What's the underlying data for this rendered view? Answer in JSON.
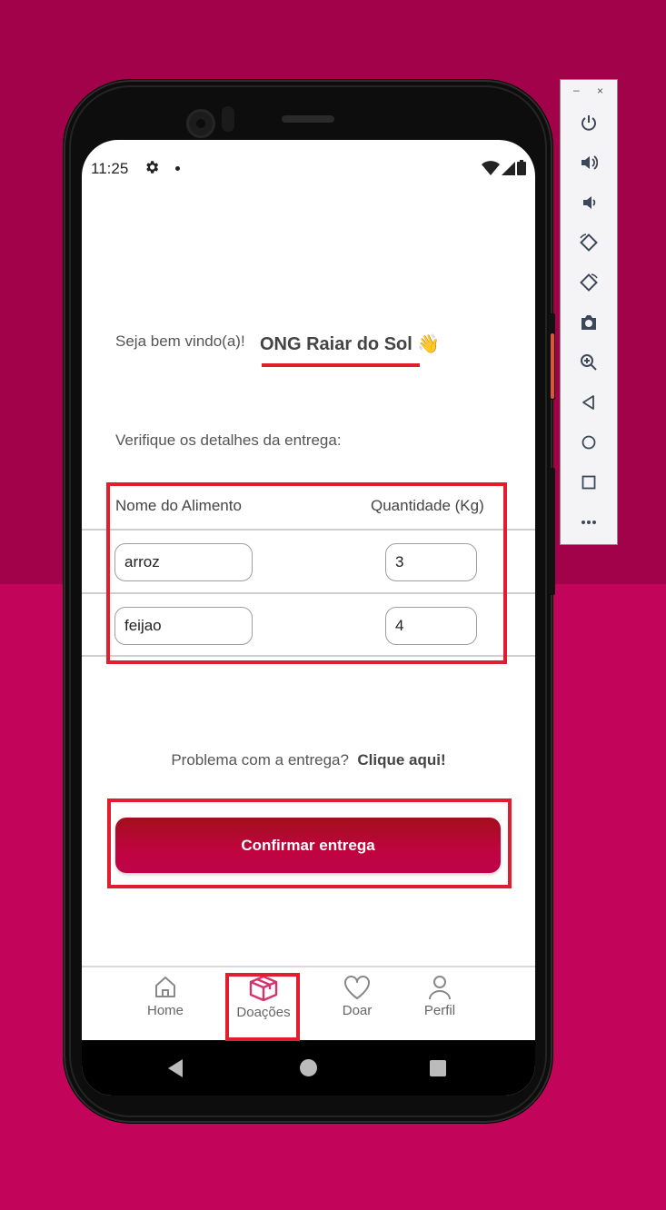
{
  "status_bar": {
    "time": "11:25"
  },
  "header": {
    "welcome": "Seja bem vindo(a)!",
    "org_name": "ONG Raiar do Sol 👋"
  },
  "subtitle": "Verifique os detalhes da entrega:",
  "table": {
    "col_food": "Nome do Alimento",
    "col_qty": "Quantidade (Kg)",
    "rows": [
      {
        "food": "arroz",
        "qty": "3"
      },
      {
        "food": "feijao",
        "qty": "4"
      }
    ]
  },
  "problem": {
    "text": "Problema com a entrega?",
    "link": "Clique aqui!"
  },
  "confirm_button": "Confirmar entrega",
  "bottom_tabs": [
    {
      "label": "Home",
      "icon": "home-icon"
    },
    {
      "label": "Doações",
      "icon": "box-icon",
      "active": true
    },
    {
      "label": "Doar",
      "icon": "heart-icon"
    },
    {
      "label": "Perfil",
      "icon": "person-icon"
    }
  ],
  "colors": {
    "background_top": "#a2024a",
    "background_bottom": "#c2045a",
    "accent": "#c0043f",
    "highlight": "#e01e2d",
    "active_tab_icon": "#d6336c"
  },
  "emulator_toolbar": {
    "window_controls": [
      "–",
      "×"
    ],
    "buttons": [
      "power-icon",
      "volume-up-icon",
      "volume-down-icon",
      "rotate-left-icon",
      "rotate-right-icon",
      "camera-icon",
      "zoom-icon",
      "back-icon",
      "home-icon",
      "overview-icon",
      "more-icon"
    ]
  }
}
